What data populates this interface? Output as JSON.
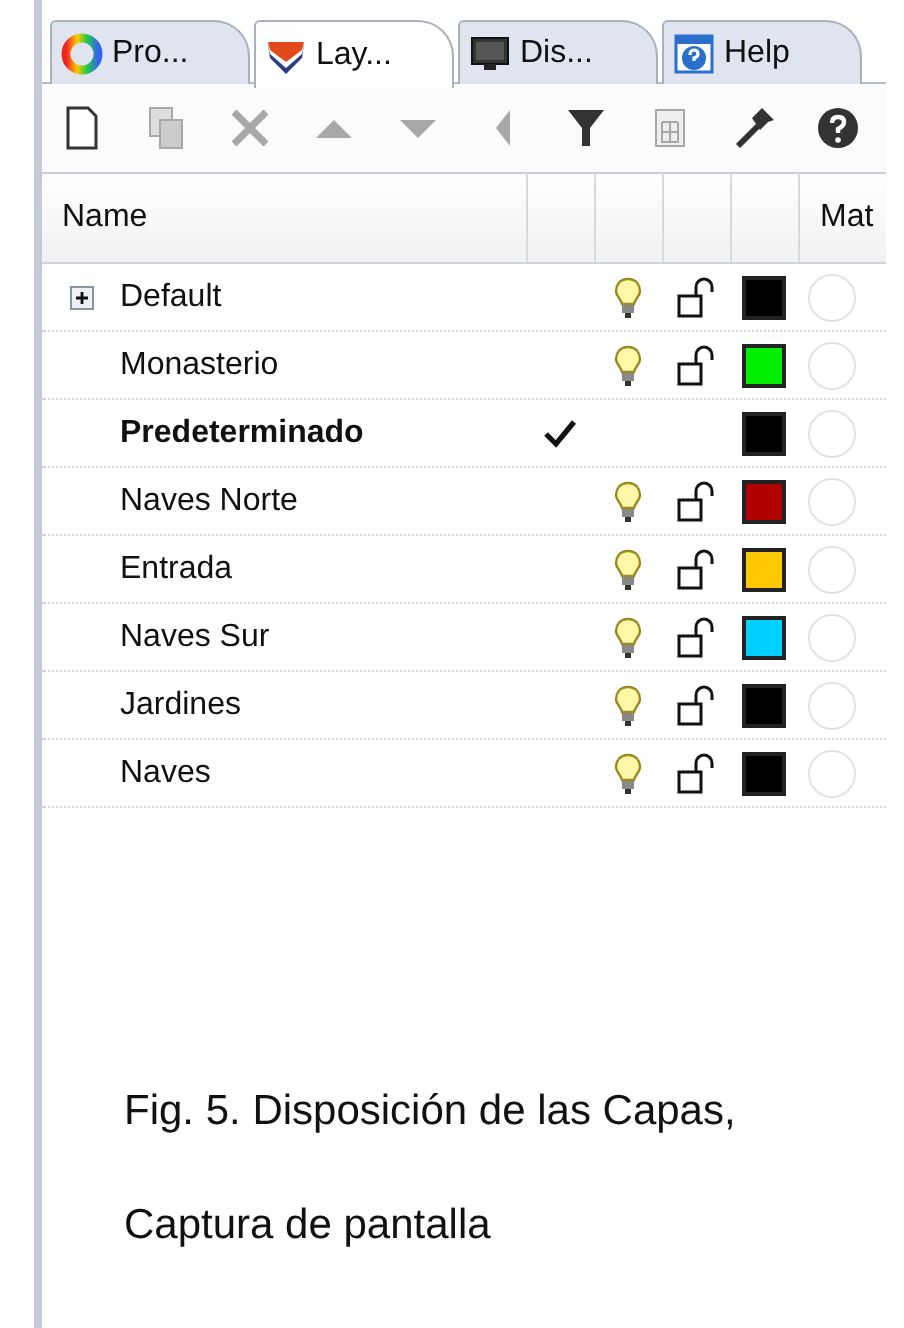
{
  "tabs": [
    {
      "label": "Pro...",
      "kind": "color-wheel",
      "selected": false
    },
    {
      "label": "Lay...",
      "kind": "layers",
      "selected": true
    },
    {
      "label": "Dis...",
      "kind": "monitor",
      "selected": false
    },
    {
      "label": "Help",
      "kind": "help",
      "selected": false
    }
  ],
  "toolbar": [
    {
      "kind": "new",
      "disabled": false
    },
    {
      "kind": "copy",
      "disabled": true
    },
    {
      "kind": "delete",
      "disabled": true
    },
    {
      "kind": "up",
      "disabled": true
    },
    {
      "kind": "down",
      "disabled": true
    },
    {
      "kind": "left",
      "disabled": true
    },
    {
      "kind": "filter",
      "disabled": false
    },
    {
      "kind": "table",
      "disabled": true
    },
    {
      "kind": "hammer",
      "disabled": false
    },
    {
      "kind": "question",
      "disabled": false
    }
  ],
  "table": {
    "columns": [
      {
        "label": "Name"
      },
      {
        "label": "Mat"
      }
    ],
    "rows": [
      {
        "name": "Default",
        "expandable": true,
        "current": false,
        "on": true,
        "locked": false,
        "color": "#000000"
      },
      {
        "name": "Monasterio",
        "expandable": false,
        "current": false,
        "on": true,
        "locked": false,
        "color": "#00ee00"
      },
      {
        "name": "Predeterminado",
        "expandable": false,
        "current": true,
        "color": "#000000"
      },
      {
        "name": "Naves Norte",
        "expandable": false,
        "current": false,
        "on": true,
        "locked": false,
        "color": "#b00000"
      },
      {
        "name": "Entrada",
        "expandable": false,
        "current": false,
        "on": true,
        "locked": false,
        "color": "#ffc800"
      },
      {
        "name": "Naves Sur",
        "expandable": false,
        "current": false,
        "on": true,
        "locked": false,
        "color": "#00d0ff"
      },
      {
        "name": "Jardines",
        "expandable": false,
        "current": false,
        "on": true,
        "locked": false,
        "color": "#000000"
      },
      {
        "name": "Naves",
        "expandable": false,
        "current": false,
        "on": true,
        "locked": false,
        "color": "#000000"
      }
    ]
  },
  "caption": [
    "Fig. 5. Disposición de las Capas,",
    "Captura de pantalla"
  ]
}
